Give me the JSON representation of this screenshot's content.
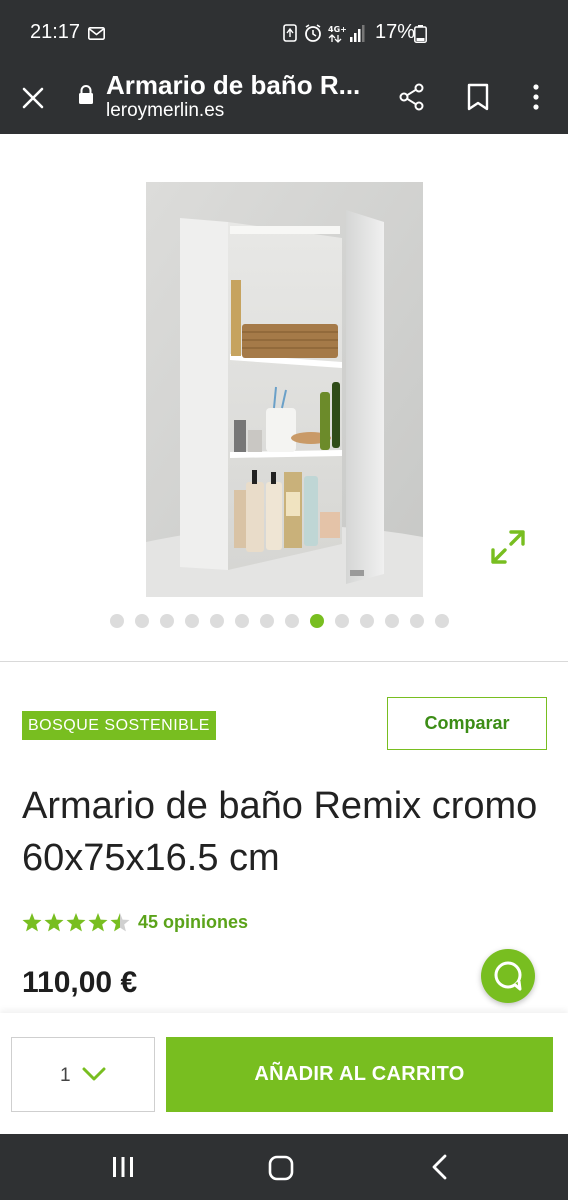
{
  "status_bar": {
    "time": "21:17",
    "battery_percent": "17%",
    "icons": [
      "mail-icon",
      "recycle-icon",
      "alarm-icon",
      "4g-icon",
      "signal-icon",
      "battery-icon"
    ]
  },
  "browser": {
    "page_title": "Armario de baño R...",
    "domain": "leroymerlin.es"
  },
  "gallery": {
    "dot_count": 14,
    "active_dot": 9
  },
  "product": {
    "badge": "BOSQUE SOSTENIBLE",
    "compare_label": "Comparar",
    "title": "Armario de baño Remix cromo 60x75x16.5 cm",
    "rating": 4.5,
    "rating_text": "45 opiniones",
    "price": "110,00 €"
  },
  "cart": {
    "quantity": "1",
    "add_label": "AÑADIR AL CARRITO"
  },
  "colors": {
    "brand_green": "#78be20",
    "dark_bar": "#2f3133"
  }
}
